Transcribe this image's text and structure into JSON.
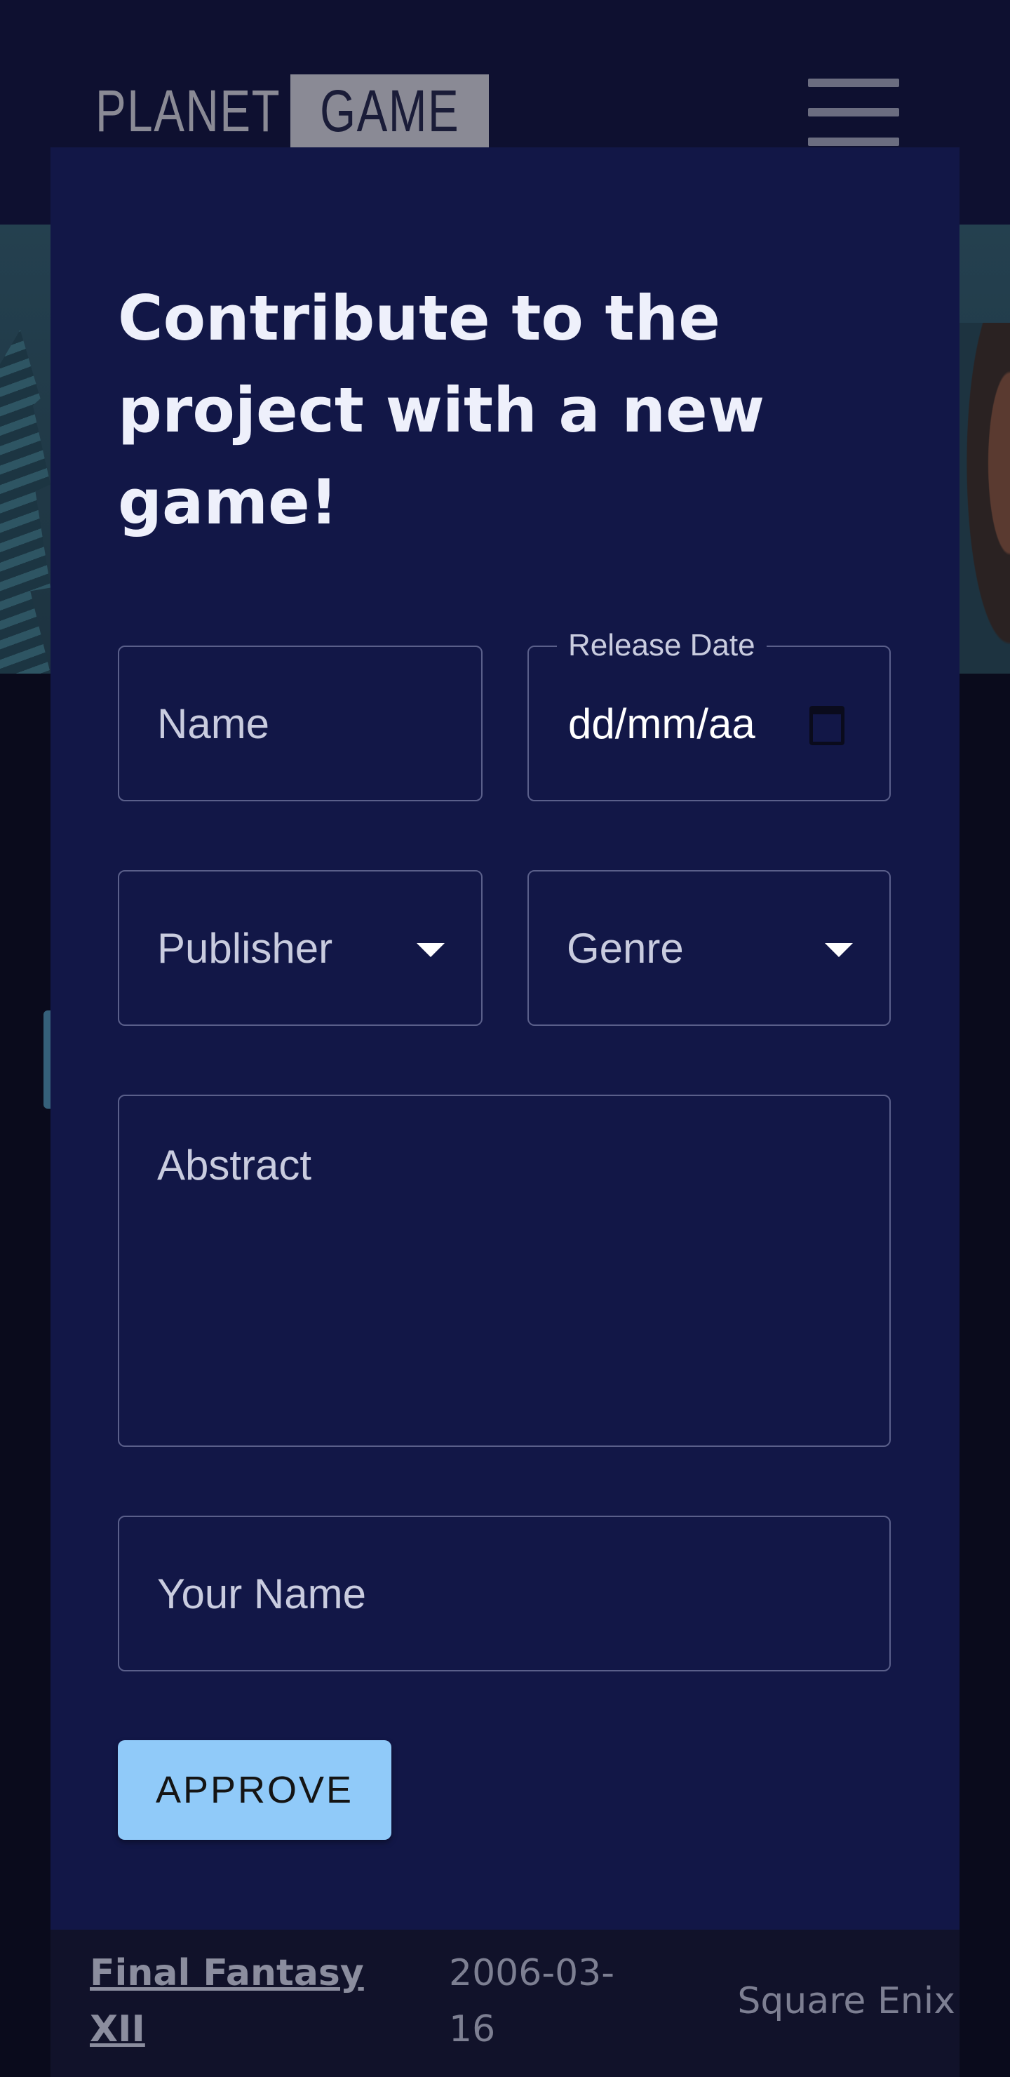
{
  "header": {
    "logo_word1": "PLANET",
    "logo_word2": "GAME",
    "menu_icon": "hamburger-menu-icon"
  },
  "modal": {
    "title": "Contribute to the project with a new game!",
    "fields": {
      "name_placeholder": "Name",
      "release_date_label": "Release Date",
      "release_date_value": "dd/mm/aa",
      "publisher_placeholder": "Publisher",
      "genre_placeholder": "Genre",
      "abstract_placeholder": "Abstract",
      "your_name_placeholder": "Your Name"
    },
    "approve_label": "APPROVE"
  },
  "background_row": {
    "title": "Final Fantasy XII",
    "date": "2006-03-16",
    "publisher": "Square Enix"
  },
  "colors": {
    "modal_bg": "#121747",
    "page_bg": "#0a0b1c",
    "button_bg": "#90caf9",
    "field_border": "#5a5f8a"
  }
}
